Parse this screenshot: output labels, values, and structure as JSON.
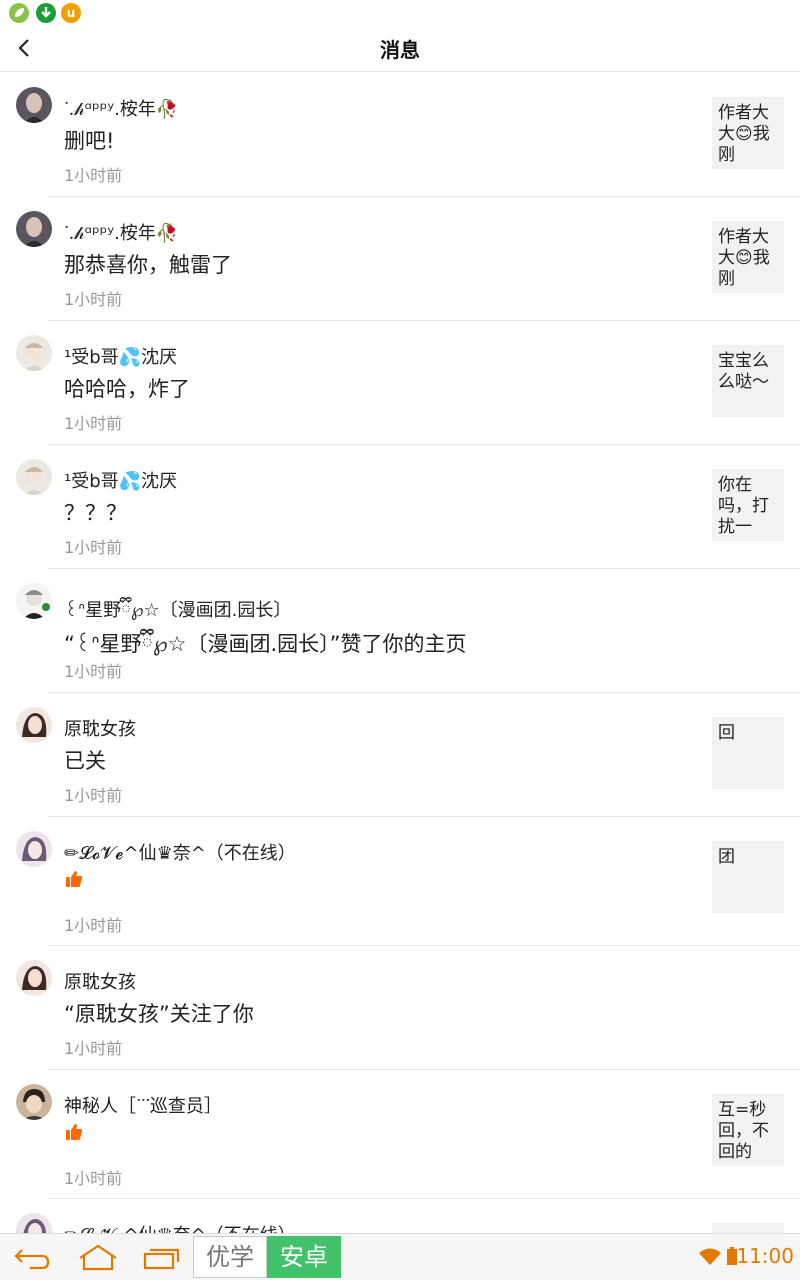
{
  "header": {
    "title": "消息"
  },
  "messages": [
    {
      "name": "ᐝ.𝒽ᵅᵖᵖʸ.桉年🥀",
      "content": "删吧!",
      "time": "1小时前",
      "preview": "作者大大😊我刚"
    },
    {
      "name": "ᐝ.𝒽ᵅᵖᵖʸ.桉年🥀",
      "content": "那恭喜你，触雷了",
      "time": "1小时前",
      "preview": "作者大大😊我刚"
    },
    {
      "name": "¹受b哥💦沈厌",
      "content": "哈哈哈，炸了",
      "time": "1小时前",
      "preview": "宝宝么么哒～"
    },
    {
      "name": "¹受b哥💦沈厌",
      "content": "？？？",
      "time": "1小时前",
      "preview": "你在吗，打扰一"
    },
    {
      "name": "꒰ᐢ星野ྀི℘☆〔漫画团.园长〕",
      "content": "“꒰ᐢ星野ྀི℘☆〔漫画团.园长〕”赞了你的主页",
      "time": "1小时前",
      "preview": ""
    },
    {
      "name": "原耽女孩",
      "content": "已关",
      "time": "1小时前",
      "preview": "回"
    },
    {
      "name": "✏𝓛𝓸𝓥𝓮^仙♛奈^（不在线）",
      "content": "",
      "time": "1小时前",
      "preview": "团",
      "thumb": true
    },
    {
      "name": "原耽女孩",
      "content": "“原耽女孩”关注了你",
      "time": "1小时前",
      "preview": ""
    },
    {
      "name": "神秘人［ᐝᐝᐝ巡查员］",
      "content": "",
      "time": "1小时前",
      "preview": "互=秒回，不回的",
      "thumb": true
    },
    {
      "name": "✏𝓛𝓸𝓥𝓮^仙♛奈^（不在线）",
      "content": "",
      "time": "",
      "preview": ""
    }
  ],
  "navbar": {
    "brand_left": "优学",
    "brand_right": "安卓",
    "time": "11:00"
  },
  "icons": {
    "back": "chevron-left-icon",
    "thumb": "thumbs-up-icon",
    "home": "home-icon",
    "recents": "recents-icon",
    "nav_back": "back-arrow-icon",
    "wifi": "wifi-icon",
    "battery": "battery-icon"
  },
  "colors": {
    "accent": "#ff6a00",
    "nav_accent": "#e07a00",
    "brand_green": "#43c26b"
  }
}
